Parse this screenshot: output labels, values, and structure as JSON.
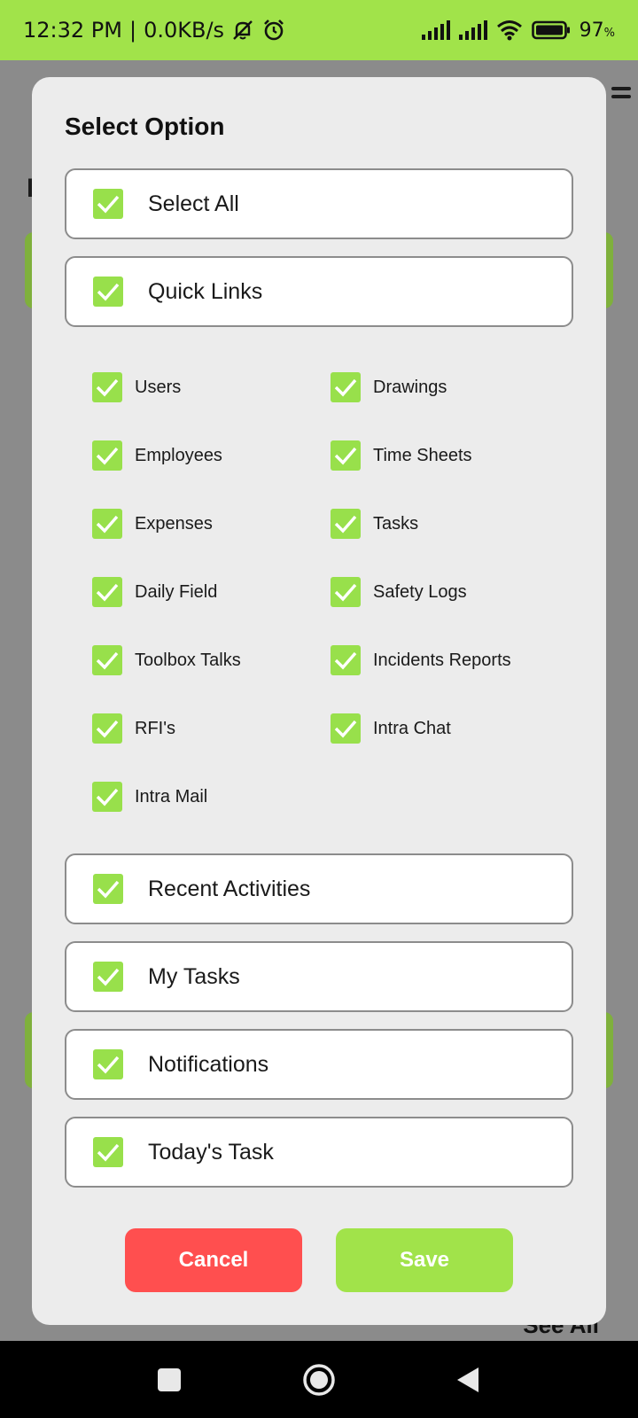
{
  "status_bar": {
    "time": "12:32 PM",
    "separator": "|",
    "speed": "0.0KB/s",
    "battery": "97",
    "battery_unit": "%",
    "icons": [
      "mute-bell-icon",
      "alarm-icon",
      "signal-icon",
      "signal-icon",
      "wifi-icon",
      "battery-icon"
    ]
  },
  "background": {
    "see_all": "See All"
  },
  "dialog": {
    "title": "Select Option",
    "select_all": {
      "label": "Select All",
      "checked": true
    },
    "quick_links": {
      "label": "Quick Links",
      "checked": true
    },
    "quick_link_items": [
      {
        "label": "Users",
        "checked": true
      },
      {
        "label": "Drawings",
        "checked": true
      },
      {
        "label": "Employees",
        "checked": true
      },
      {
        "label": "Time Sheets",
        "checked": true
      },
      {
        "label": "Expenses",
        "checked": true
      },
      {
        "label": "Tasks",
        "checked": true
      },
      {
        "label": "Daily Field",
        "checked": true
      },
      {
        "label": "Safety Logs",
        "checked": true
      },
      {
        "label": "Toolbox Talks",
        "checked": true
      },
      {
        "label": "Incidents Reports",
        "checked": true
      },
      {
        "label": "RFI's",
        "checked": true
      },
      {
        "label": "Intra Chat",
        "checked": true
      },
      {
        "label": "Intra Mail",
        "checked": true
      }
    ],
    "sections": [
      {
        "label": "Recent Activities",
        "checked": true
      },
      {
        "label": "My Tasks",
        "checked": true
      },
      {
        "label": "Notifications",
        "checked": true
      },
      {
        "label": "Today's Task",
        "checked": true
      }
    ],
    "cancel_label": "Cancel",
    "save_label": "Save"
  },
  "colors": {
    "accent_green": "#a1e34a",
    "checkbox_green": "#98e04b",
    "cancel_red": "#ff4f4f"
  }
}
